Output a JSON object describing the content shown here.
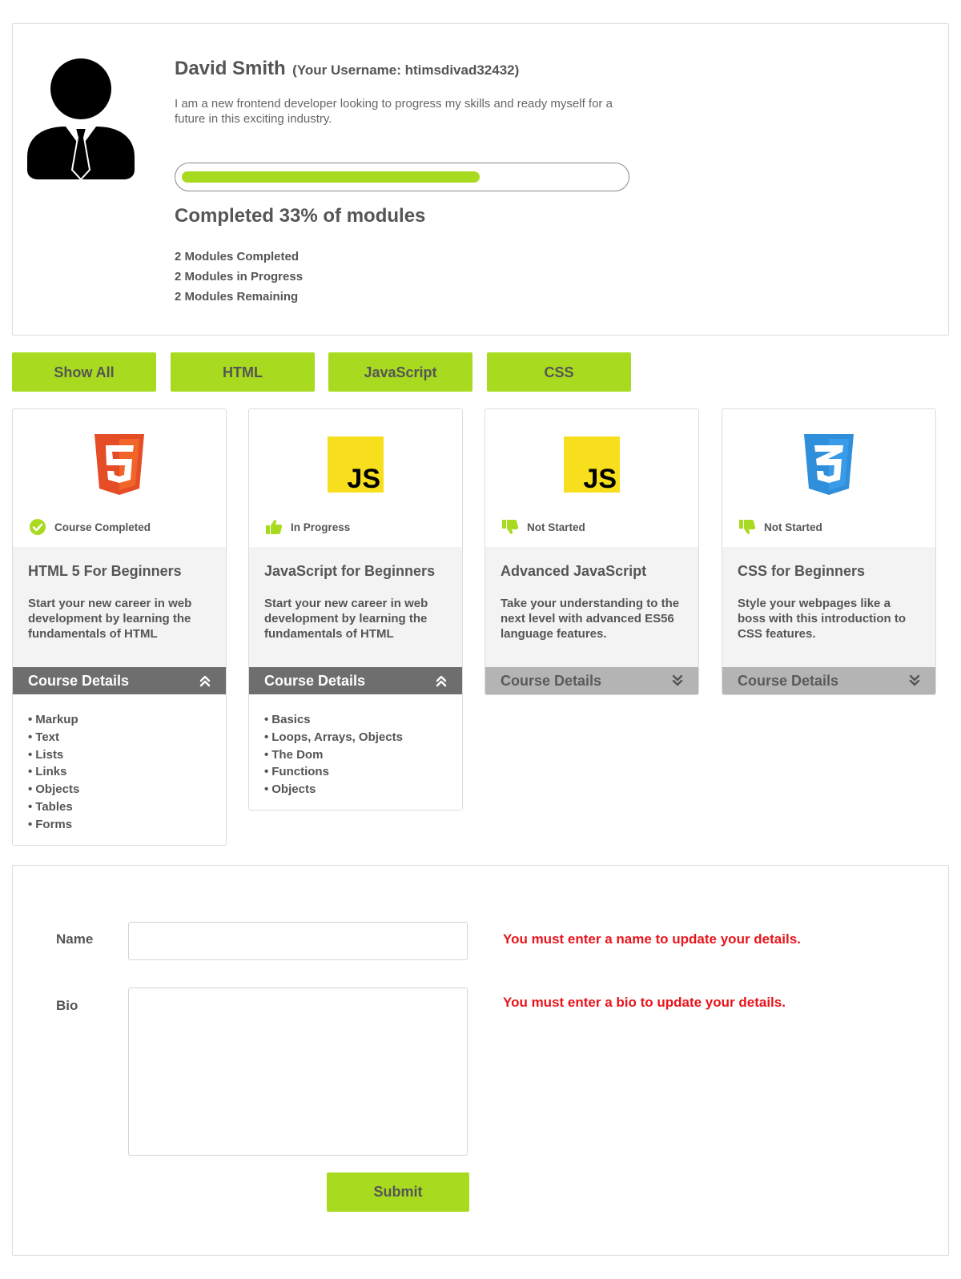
{
  "profile": {
    "name": "David Smith",
    "username_text": "(Your Username: htimsdivad32432)",
    "bio": "I am a new frontend developer looking to progress my skills and ready myself for a future in this exciting industry.",
    "progress_fraction": 0.33,
    "completed_text": "Completed 33% of modules",
    "stats": [
      "2 Modules Completed",
      "2 Modules in Progress",
      "2 Modules Remaining"
    ],
    "avatar_icon": "user-avatar-icon"
  },
  "filters": [
    "Show All",
    "HTML",
    "JavaScript",
    "CSS"
  ],
  "courses": [
    {
      "logo": "html5-logo-icon",
      "status_icon": "check-circle-icon",
      "status": "Course Completed",
      "title": "HTML 5 For Beginners",
      "description": "Start your new career in web development by learning the fundamentals of HTML",
      "details_label": "Course Details",
      "expanded": true,
      "details": [
        "Markup",
        "Text",
        "Lists",
        "Links",
        "Objects",
        "Tables",
        "Forms"
      ]
    },
    {
      "logo": "javascript-logo-icon",
      "status_icon": "thumbs-up-icon",
      "status": "In Progress",
      "title": "JavaScript for Beginners",
      "description": "Start your new career in web development by learning the fundamentals of HTML",
      "details_label": "Course Details",
      "expanded": true,
      "details": [
        "Basics",
        "Loops, Arrays, Objects",
        "The Dom",
        "Functions",
        "Objects"
      ]
    },
    {
      "logo": "javascript-logo-icon",
      "status_icon": "thumbs-down-icon",
      "status": "Not Started",
      "title": "Advanced JavaScript",
      "description": "Take your understanding to the next level with advanced ES56 language features.",
      "details_label": "Course Details",
      "expanded": false,
      "details": []
    },
    {
      "logo": "css3-logo-icon",
      "status_icon": "thumbs-down-icon",
      "status": "Not Started",
      "title": "CSS for Beginners",
      "description": "Style your webpages like a boss with this introduction to CSS features.",
      "details_label": "Course Details",
      "expanded": false,
      "details": []
    }
  ],
  "form": {
    "name_label": "Name",
    "bio_label": "Bio",
    "name_value": "",
    "bio_value": "",
    "name_error": "You must enter a name to update your details.",
    "bio_error": "You must enter a bio to update your details.",
    "submit_label": "Submit"
  },
  "colors": {
    "accent": "#a8db1f",
    "error": "#e8141b",
    "html5": "#e44d26",
    "javascript": "#f7df1e",
    "css3": "#2f8fdb"
  }
}
